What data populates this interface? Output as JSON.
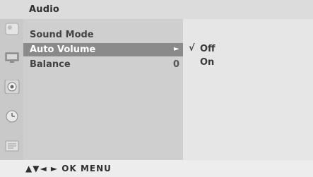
{
  "title": "Audio",
  "icons": [
    "picture-icon",
    "screen-icon",
    "audio-icon",
    "time-icon",
    "option-icon"
  ],
  "menu": {
    "items": [
      {
        "label": "Sound Mode",
        "value": "",
        "arrow": ""
      },
      {
        "label": "Auto Volume",
        "value": "",
        "arrow": "►"
      },
      {
        "label": "Balance",
        "value": "0",
        "arrow": ""
      }
    ]
  },
  "submenu": {
    "check_mark": "√",
    "options": [
      "Off",
      "On"
    ]
  },
  "footer": {
    "keys": "▲▼◄ ► OK MENU"
  },
  "colors": {
    "selected_bg": "#8a8a8a",
    "panel_bg": "#cfcfcf"
  }
}
